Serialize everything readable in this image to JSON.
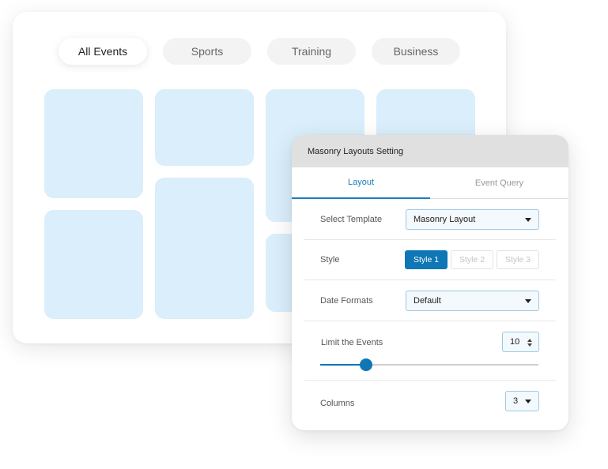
{
  "filters": [
    {
      "label": "All Events",
      "active": true
    },
    {
      "label": "Sports",
      "active": false
    },
    {
      "label": "Training",
      "active": false
    },
    {
      "label": "Business",
      "active": false
    }
  ],
  "panel": {
    "title": "Masonry Layouts Setting",
    "tabs": [
      {
        "label": "Layout",
        "active": true
      },
      {
        "label": "Event Query",
        "active": false
      }
    ],
    "select_template": {
      "label": "Select Template",
      "value": "Masonry Layout"
    },
    "style": {
      "label": "Style",
      "options": [
        {
          "label": "Style 1",
          "active": true
        },
        {
          "label": "Style 2",
          "active": false
        },
        {
          "label": "Style 3",
          "active": false
        }
      ]
    },
    "date_formats": {
      "label": "Date Formats",
      "value": "Default"
    },
    "limit_events": {
      "label": "Limit the Events",
      "value": "10",
      "slider_fraction": 0.21
    },
    "columns": {
      "label": "Columns",
      "value": "3"
    }
  },
  "colors": {
    "accent": "#0f77b5",
    "tile": "#daeefc",
    "header_bg": "#e0e0e0"
  }
}
